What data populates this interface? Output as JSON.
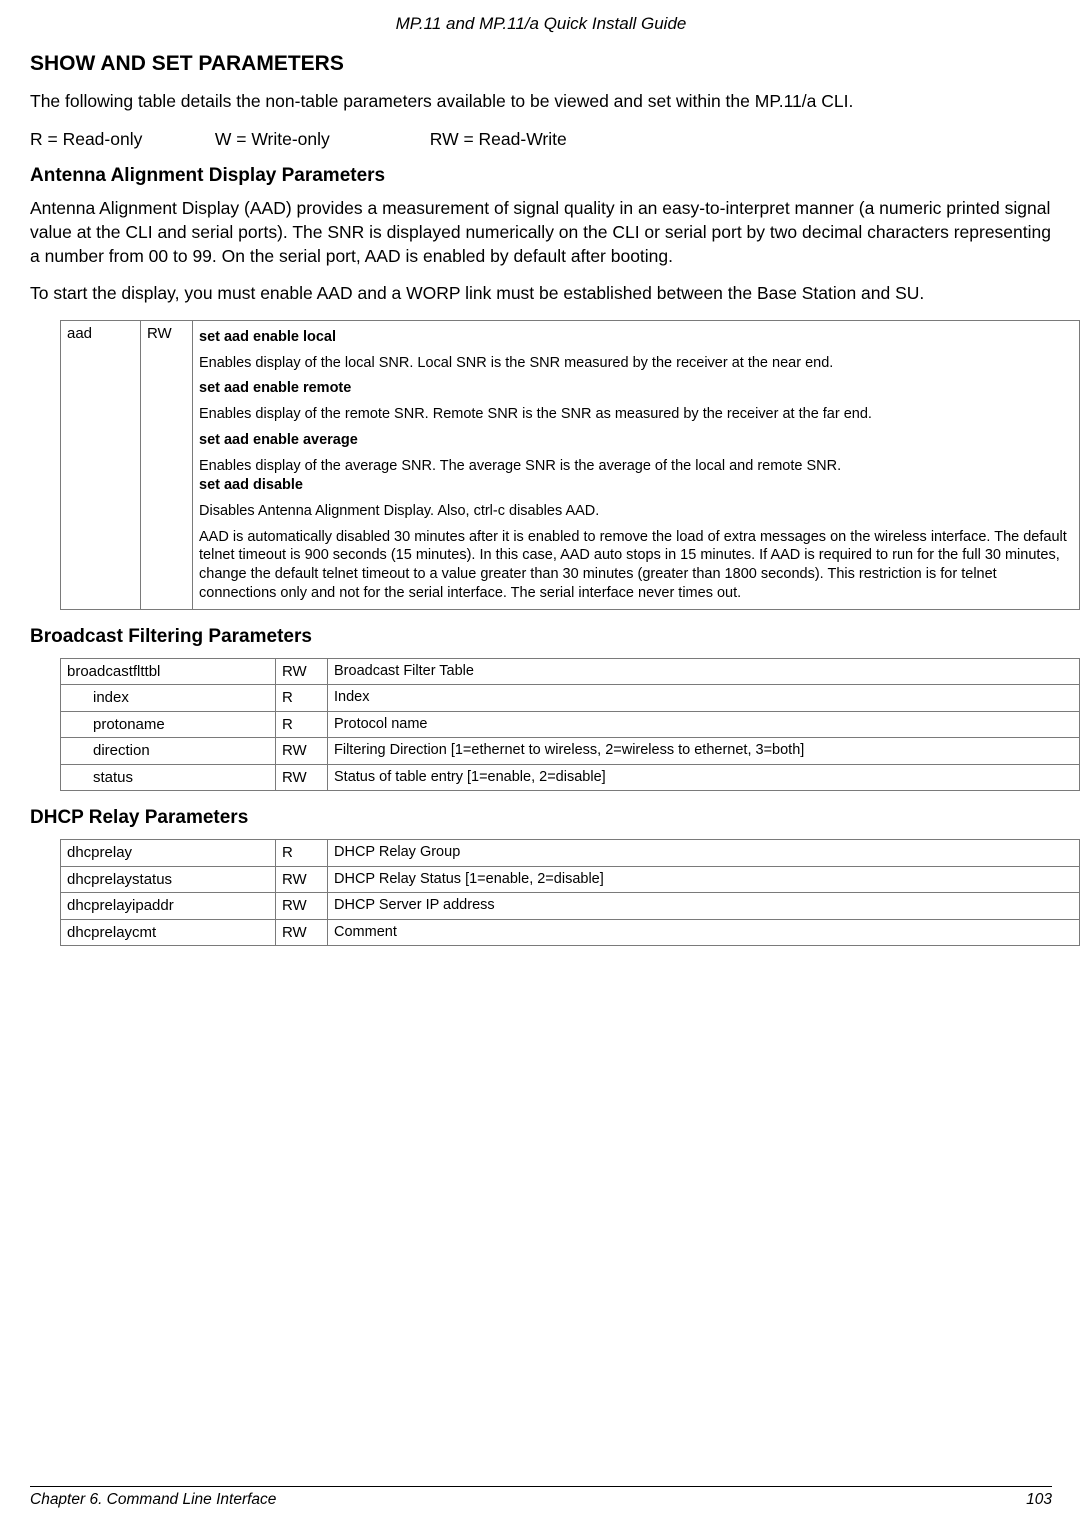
{
  "header": {
    "title": "MP.11 and MP.11/a Quick Install Guide"
  },
  "h1": "SHOW AND SET PARAMETERS",
  "intro": "The following table details the non-table parameters available to be viewed and set within the MP.11/a CLI.",
  "legend": {
    "r": "R = Read-only",
    "w": "W = Write-only",
    "rw": "RW = Read-Write"
  },
  "h2a": "Antenna Alignment Display Parameters",
  "aad_p1": "Antenna Alignment Display (AAD) provides a measurement of signal quality in an easy-to-interpret manner (a numeric printed signal value at the CLI and serial ports). The SNR is displayed numerically on the CLI or serial port by two decimal characters representing a number from 00 to 99. On the serial port, AAD is enabled by default after booting.",
  "aad_p2": "To start the display, you must enable AAD and a WORP link must be established between the Base Station and SU.",
  "aad_table": {
    "name": "aad",
    "access": "RW",
    "desc": {
      "l1": "set aad enable local",
      "l2": "Enables display of the local SNR. Local SNR is the SNR measured by the receiver at the near end.",
      "l3": "set aad enable remote",
      "l4": "Enables display of the remote SNR. Remote SNR is the SNR as measured by the receiver at the far end.",
      "l5": "set aad enable average",
      "l6a": "Enables display of the average SNR. The average SNR is the average of the local and remote SNR.",
      "l6b": "set aad disable",
      "l7": "Disables Antenna Alignment Display. Also, ctrl-c disables AAD.",
      "l8": "AAD is automatically disabled 30 minutes after it is enabled to remove the load of extra messages on the wireless interface. The default telnet timeout is 900 seconds (15 minutes). In this case, AAD auto stops in 15 minutes. If AAD is required to run for the full 30 minutes, change the default telnet timeout to a value greater than 30 minutes (greater than 1800 seconds). This restriction is for telnet connections only and not for the serial interface. The serial interface never times out."
    }
  },
  "h2b": "Broadcast Filtering Parameters",
  "bf_rows": [
    {
      "name": "broadcastflttbl",
      "access": "RW",
      "desc": "Broadcast Filter Table",
      "indent": false
    },
    {
      "name": "index",
      "access": "R",
      "desc": "Index",
      "indent": true
    },
    {
      "name": "protoname",
      "access": "R",
      "desc": "Protocol name",
      "indent": true
    },
    {
      "name": "direction",
      "access": "RW",
      "desc": "Filtering Direction [1=ethernet to wireless, 2=wireless to ethernet, 3=both]",
      "indent": true
    },
    {
      "name": "status",
      "access": "RW",
      "desc": "Status of table entry [1=enable, 2=disable]",
      "indent": true
    }
  ],
  "h2c": "DHCP Relay Parameters",
  "dhcp_rows": [
    {
      "name": "dhcprelay",
      "access": "R",
      "desc": "DHCP Relay Group"
    },
    {
      "name": "dhcprelaystatus",
      "access": "RW",
      "desc": "DHCP Relay Status [1=enable, 2=disable]"
    },
    {
      "name": "dhcprelayipaddr",
      "access": "RW",
      "desc": "DHCP Server IP address"
    },
    {
      "name": "dhcprelaycmt",
      "access": "RW",
      "desc": "Comment"
    }
  ],
  "footer": {
    "left": "Chapter 6.  Command Line Interface",
    "right": "103"
  }
}
